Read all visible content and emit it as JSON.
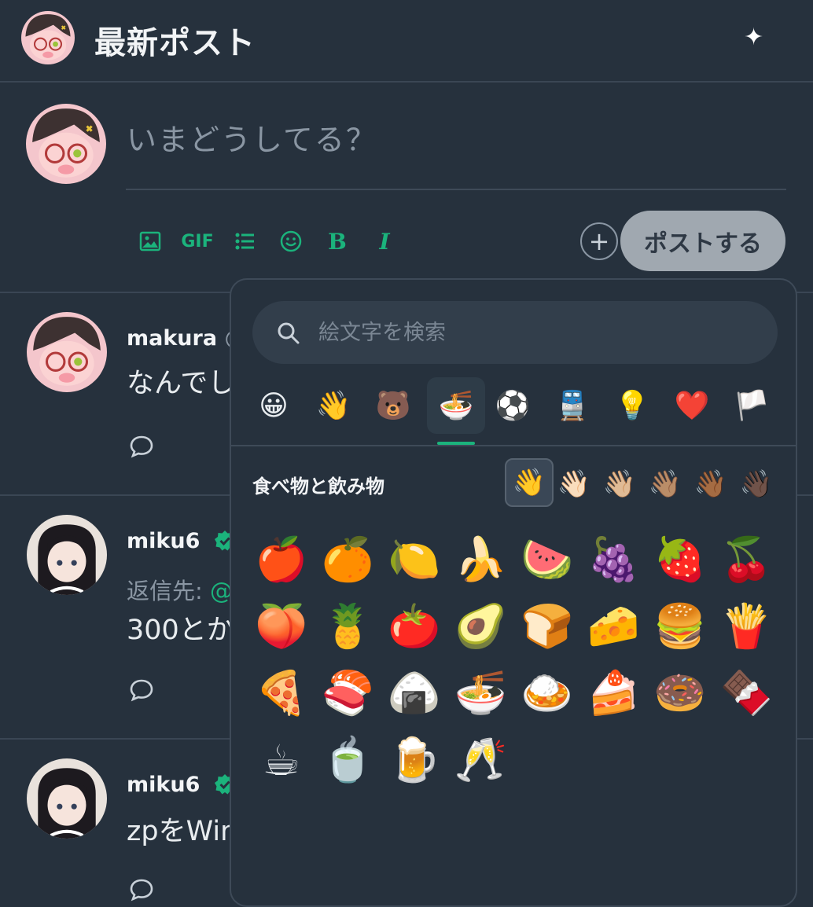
{
  "header": {
    "title": "最新ポスト",
    "sparkle_icon": "✦"
  },
  "compose": {
    "placeholder": "いまどうしてる？",
    "tools": {
      "gif": "GIF",
      "bold": "B",
      "italic": "I"
    },
    "add_icon": "+",
    "post_button": "ポストする"
  },
  "posts": [
    {
      "name": "makura",
      "handle": "@",
      "text": "なんでし"
    },
    {
      "name": "miku6",
      "reply_label": "返信先:",
      "reply_link": "@",
      "text": "300とか"
    },
    {
      "name": "miku6",
      "text": "zpをWin"
    }
  ],
  "picker": {
    "search_placeholder": "絵文字を検索",
    "categories": [
      "😀",
      "👋",
      "🐻",
      "🍜",
      "⚽",
      "🚆",
      "💡",
      "❤️",
      "🏳️"
    ],
    "active_category": "🍜",
    "section_title": "食べ物と飲み物",
    "skin_tones": [
      "👋",
      "👋🏻",
      "👋🏼",
      "👋🏽",
      "👋🏾",
      "👋🏿"
    ],
    "emojis": [
      "🍎",
      "🍊",
      "🍋",
      "🍌",
      "🍉",
      "🍇",
      "🍓",
      "🍒",
      "🍑",
      "🍍",
      "🍅",
      "🥑",
      "🍞",
      "🧀",
      "🍔",
      "🍟",
      "🍕",
      "🍣",
      "🍙",
      "🍜",
      "🍛",
      "🍰",
      "🍩",
      "🍫",
      "☕",
      "🍵",
      "🍺",
      "🥂"
    ]
  },
  "colors": {
    "accent": "#1bb37c",
    "background": "#26313d",
    "post_button_bg": "#a0a8b0"
  }
}
